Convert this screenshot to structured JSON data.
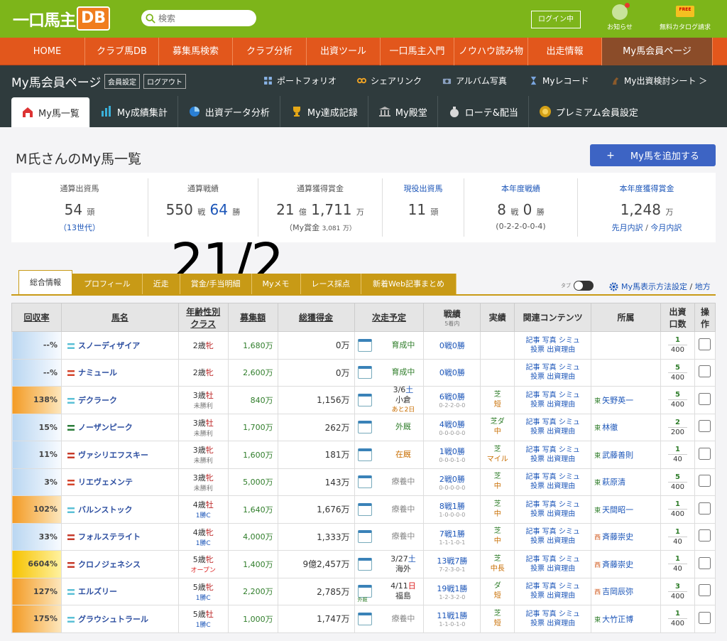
{
  "header": {
    "logo_text": "一口馬主",
    "logo_badge": "DB",
    "search_placeholder": "検索",
    "login_label": "ログイン中",
    "notify_label": "お知らせ",
    "catalog_label": "無料カタログ請求",
    "catalog_badge": "FREE"
  },
  "main_nav": [
    "HOME",
    "クラブ馬DB",
    "募集馬検索",
    "クラブ分析",
    "出資ツール",
    "一口馬主入門",
    "ノウハウ読み物",
    "出走情報",
    "My馬会員ページ"
  ],
  "sub_header": {
    "title": "My馬会員ページ",
    "settings": "会員設定",
    "logout": "ログアウト",
    "links": [
      "ポートフォリオ",
      "シェアリンク",
      "アルバム写真",
      "Myレコード",
      "My出資検討シート ＞"
    ]
  },
  "tabs": [
    "My馬一覧",
    "My成績集計",
    "出資データ分析",
    "My達成記録",
    "My殿堂",
    "ローテ&配当",
    "プレミアム会員設定"
  ],
  "page": {
    "title": "M氏さんのMy馬一覧",
    "add_button": "My馬を追加する",
    "overlay_text": "21/2"
  },
  "stats": [
    {
      "label": "通算出資馬",
      "v1": "54",
      "u1": "頭",
      "sub": "（13世代）"
    },
    {
      "label": "通算戦績",
      "v1": "550",
      "u1": "戦",
      "v2": "64",
      "u2": "勝",
      "sub": ""
    },
    {
      "label": "通算獲得賞金",
      "v1": "21",
      "u1": "億",
      "v2": "1,711",
      "u2": "万",
      "sub": "（My賞金",
      "sub2": "3,081",
      "sub3": "万）"
    },
    {
      "label": "現役出資馬",
      "v1": "11",
      "u1": "頭",
      "sub": ""
    },
    {
      "label": "本年度戦績",
      "v1": "8",
      "u1": "戦",
      "v2": "0",
      "u2": "勝",
      "sub": "(0-2-2-0-0-4)"
    },
    {
      "label": "本年度獲得賞金",
      "v1": "1,248",
      "u1": "万",
      "sub": "先月内訳",
      "sub_sep": "/",
      "sub2": "今月内訳"
    }
  ],
  "info_tabs": [
    "総合情報",
    "プロフィール",
    "近走",
    "賞金/手当明細",
    "Myメモ",
    "レース採点",
    "新着Web記事まとめ"
  ],
  "toggle_label": "タブ",
  "display_settings": "My馬表示方法設定",
  "display_settings_sep": "/",
  "display_area": "地方",
  "table": {
    "headers": [
      "回収率",
      "馬名",
      "年齢性別",
      "クラス",
      "募集額",
      "総獲得金",
      "次走予定",
      "戦績",
      "5着内",
      "実績",
      "関連コンテンツ",
      "所属",
      "出資",
      "口数",
      "操",
      "作"
    ],
    "rows": [
      {
        "rate": "--%",
        "rc": "r-blue",
        "name": "スノーディザイア",
        "flag": "#5bc0d6",
        "age": "2歳",
        "sex": "牝",
        "cls": "",
        "clsc": "",
        "amount": "1,680万",
        "total": "0万",
        "next": "育成中",
        "nc": "g",
        "rec": "0戦0勝",
        "rsub": "",
        "perf1": "",
        "perf2": "",
        "stable": "",
        "region": "",
        "shares": "1",
        "total_shares": "400"
      },
      {
        "rate": "--%",
        "rc": "r-blue",
        "name": "ナミュール",
        "flag": "#d4452c",
        "age": "2歳",
        "sex": "牝",
        "cls": "",
        "clsc": "",
        "amount": "2,600万",
        "total": "0万",
        "next": "育成中",
        "nc": "g",
        "rec": "0戦0勝",
        "rsub": "",
        "perf1": "",
        "perf2": "",
        "stable": "",
        "region": "",
        "shares": "5",
        "total_shares": "400"
      },
      {
        "rate": "138%",
        "rc": "r-orange",
        "name": "デクラーク",
        "flag": "#5bc0d6",
        "age": "3歳",
        "sex": "牡",
        "cls": "未勝利",
        "clsc": "",
        "amount": "840万",
        "total": "1,156万",
        "next": "",
        "nc": "d",
        "nd1": "3/6",
        "nd1b": "土",
        "nd2": "小倉",
        "nd3": "あと2日",
        "rec": "6戦0勝",
        "rsub": "0-2-2-0-0",
        "perf1": "芝",
        "perf2": "短",
        "stable": "矢野英一",
        "region": "東",
        "shares": "5",
        "total_shares": "400"
      },
      {
        "rate": "15%",
        "rc": "r-blue",
        "name": "ノーザンピーク",
        "flag": "#2b7d3a",
        "age": "3歳",
        "sex": "牡",
        "cls": "未勝利",
        "clsc": "",
        "amount": "1,700万",
        "total": "262万",
        "next": "外厩",
        "nc": "g",
        "rec": "4戦0勝",
        "rsub": "0-0-0-0-0",
        "perf1": "芝ダ",
        "perf2": "中",
        "stable": "林徹",
        "region": "東",
        "shares": "2",
        "total_shares": "200"
      },
      {
        "rate": "11%",
        "rc": "r-blue",
        "name": "ヴァシリエフスキー",
        "flag": "#c73b2a",
        "age": "3歳",
        "sex": "牝",
        "cls": "未勝利",
        "clsc": "",
        "amount": "1,600万",
        "total": "181万",
        "next": "在厩",
        "nc": "o",
        "rec": "1戦0勝",
        "rsub": "0-0-0-1-0",
        "perf1": "芝",
        "perf2": "マイル",
        "stable": "武藤善則",
        "region": "東",
        "shares": "1",
        "total_shares": "40"
      },
      {
        "rate": "3%",
        "rc": "r-blue",
        "name": "リエヴェメンテ",
        "flag": "#d4452c",
        "age": "3歳",
        "sex": "牝",
        "cls": "未勝利",
        "clsc": "",
        "amount": "5,000万",
        "total": "143万",
        "next": "療養中",
        "nc": "gr",
        "rec": "2戦0勝",
        "rsub": "0-0-0-0-0",
        "perf1": "芝",
        "perf2": "中",
        "stable": "萩原清",
        "region": "東",
        "shares": "5",
        "total_shares": "400"
      },
      {
        "rate": "102%",
        "rc": "r-orange",
        "name": "バルンストック",
        "flag": "#5bc0d6",
        "age": "4歳",
        "sex": "牡",
        "cls": "1勝C",
        "clsc": "b",
        "amount": "1,640万",
        "total": "1,676万",
        "next": "療養中",
        "nc": "gr",
        "rec": "8戦1勝",
        "rsub": "1-0-0-0-0",
        "perf1": "芝",
        "perf2": "中",
        "stable": "天間昭一",
        "region": "東",
        "shares": "1",
        "total_shares": "400"
      },
      {
        "rate": "33%",
        "rc": "r-blue",
        "name": "フォルステライト",
        "flag": "#c73b2a",
        "age": "4歳",
        "sex": "牝",
        "cls": "1勝C",
        "clsc": "b",
        "amount": "4,000万",
        "total": "1,333万",
        "next": "療養中",
        "nc": "gr",
        "rec": "7戦1勝",
        "rsub": "1-1-1-0-1",
        "perf1": "芝",
        "perf2": "中",
        "stable": "斉藤崇史",
        "region": "西",
        "shares": "1",
        "total_shares": "40"
      },
      {
        "rate": "6604%",
        "rc": "r-yellow",
        "name": "クロノジェネシス",
        "flag": "#c73b2a",
        "age": "5歳",
        "sex": "牝",
        "cls": "オープン",
        "clsc": "r",
        "amount": "1,400万",
        "total": "9億2,457万",
        "next": "",
        "nc": "d",
        "nd1": "3/27",
        "nd1b": "土",
        "nd2": "海外",
        "nd3": "",
        "rec": "13戦7勝",
        "rsub": "7-2-3-0-1",
        "perf1": "芝",
        "perf2": "中長",
        "stable": "斉藤崇史",
        "region": "西",
        "shares": "1",
        "total_shares": "40"
      },
      {
        "rate": "127%",
        "rc": "r-orange",
        "name": "エルズリー",
        "flag": "#5bc0d6",
        "age": "5歳",
        "sex": "牝",
        "cls": "1勝C",
        "clsc": "b",
        "amount": "2,200万",
        "total": "2,785万",
        "next": "",
        "nc": "d",
        "nd1": "4/11",
        "nd1r": "日",
        "nd2": "福島",
        "nd3": "",
        "rec": "19戦1勝",
        "rsub": "1-2-3-2-0",
        "perf1": "ダ",
        "perf2": "短",
        "stable": "吉岡辰弥",
        "region": "西",
        "shares": "3",
        "total_shares": "400"
      },
      {
        "rate": "175%",
        "rc": "r-orange",
        "name": "グラウシュトラール",
        "flag": "#5bc0d6",
        "age": "5歳",
        "sex": "牡",
        "cls": "1勝C",
        "clsc": "b",
        "amount": "1,000万",
        "total": "1,747万",
        "next": "療養中",
        "nc": "gr",
        "rec": "11戦1勝",
        "rsub": "1-1-0-1-0",
        "perf1": "芝",
        "perf2": "短",
        "stable": "大竹正博",
        "region": "東",
        "shares": "1",
        "total_shares": "400"
      }
    ],
    "related_top": "記事 写真 シミュ",
    "related_bottom": "投票 出資理由",
    "next_small": "外厩"
  }
}
